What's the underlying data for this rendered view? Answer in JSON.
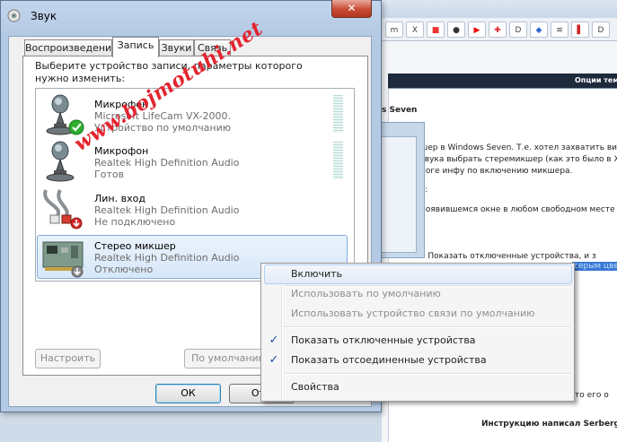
{
  "browser": {
    "tab_icons": [
      "m",
      "X",
      "",
      "",
      "",
      "",
      "D",
      "",
      "",
      "",
      "D",
      "",
      ""
    ],
    "header_text": "Опции темы",
    "lines": [
      "s Seven",
      "шер в Windows Seven. Т.е. хотел захватить ви",
      "звука выбрать стеремикшер (как это было в Х",
      "ноге инфу по включению микшера.",
      "в:",
      "появившемся окне в любом свободном месте",
      "а Показать отключенные устройства, и з",
      "серым цве",
      "то его о",
      "Инструкцию написал Serberg"
    ]
  },
  "dialog": {
    "title": "Звук",
    "close_label": "✕",
    "tabs": [
      "Воспроизведение",
      "Запись",
      "Звуки",
      "Связь"
    ],
    "active_tab": "Запись",
    "instruction": "Выберите устройство записи, параметры которого нужно изменить:",
    "devices": [
      {
        "name": "Микрофон",
        "line1": "Microsoft LifeCam VX-2000.",
        "line2": "Устройство по умолчанию",
        "status": "default",
        "icon": "microphone-icon"
      },
      {
        "name": "Микрофон",
        "line1": "Realtek High Definition Audio",
        "line2": "Готов",
        "status": "ready",
        "icon": "microphone-icon"
      },
      {
        "name": "Лин. вход",
        "line1": "Realtek High Definition Audio",
        "line2": "Не подключено",
        "status": "unplugged",
        "icon": "line-in-cable-icon"
      },
      {
        "name": "Стерео микшер",
        "line1": "Realtek High Definition Audio",
        "line2": "Отключено",
        "status": "disabled",
        "icon": "sound-card-icon"
      }
    ],
    "configure_button": "Настроить",
    "default_button": "По умолчанию",
    "ok_button": "ОК",
    "cancel_button": "Отм"
  },
  "context_menu": {
    "items": [
      {
        "label": "Включить",
        "enabled": true,
        "checked": false,
        "highlighted": true
      },
      {
        "label": "Использовать по умолчанию",
        "enabled": false,
        "checked": false
      },
      {
        "label": "Использовать устройство связи по умолчанию",
        "enabled": false,
        "checked": false
      },
      {
        "label": "Показать отключенные устройства",
        "enabled": true,
        "checked": true
      },
      {
        "label": "Показать отсоединенные устройства",
        "enabled": true,
        "checked": true
      },
      {
        "label": "Свойства",
        "enabled": true,
        "checked": false
      }
    ]
  },
  "watermark": "www.bojmotuhi.net",
  "colors": {
    "checkmark": "#1d4fa8",
    "watermark": "#e3252f",
    "default_badge": "#2fae2f",
    "unplugged_badge": "#d22b2b"
  }
}
